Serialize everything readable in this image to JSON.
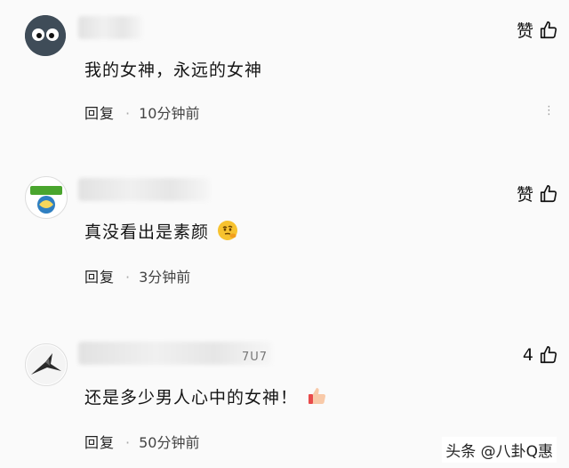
{
  "comments": [
    {
      "text": "我的女神，永远的女神",
      "reply_label": "回复",
      "separator": "·",
      "time": "10分钟前",
      "like_label": "赞",
      "avatar_icon": "cartoon-face-avatar"
    },
    {
      "text": "真没看出是素颜",
      "reply_label": "回复",
      "separator": "·",
      "time": "3分钟前",
      "like_label": "赞",
      "avatar_icon": "badge-avatar"
    },
    {
      "text": "还是多少男人心中的女神！",
      "reply_label": "回复",
      "separator": "·",
      "time": "50分钟前",
      "like_count": "4",
      "avatar_icon": "bird-avatar",
      "name_fragment": "7U7"
    }
  ],
  "watermark": "头条 @八卦Q惠",
  "colors": {
    "background": "#fafafa",
    "text": "#151515",
    "muted": "#999999"
  }
}
